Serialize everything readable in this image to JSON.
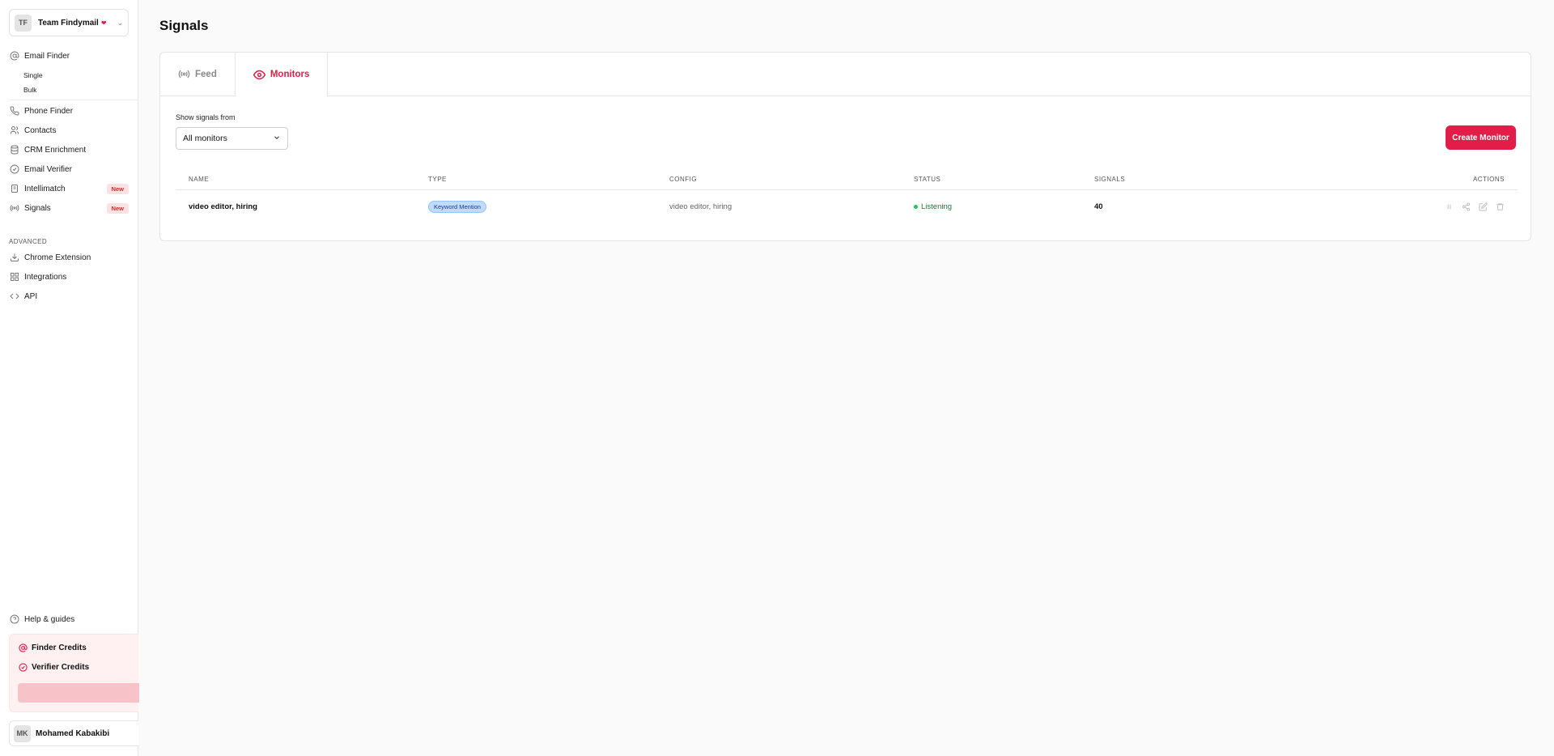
{
  "sidebar": {
    "team": {
      "initials": "TF",
      "name": "Team Findymail"
    },
    "nav": {
      "email_finder": "Email Finder",
      "single": "Single",
      "bulk": "Bulk",
      "phone_finder": "Phone Finder",
      "contacts": "Contacts",
      "crm_enrichment": "CRM Enrichment",
      "email_verifier": "Email Verifier",
      "intellimatch": "Intellimatch",
      "signals": "Signals",
      "new_badge": "New"
    },
    "advanced_label": "ADVANCED",
    "advanced": {
      "chrome_extension": "Chrome Extension",
      "integrations": "Integrations",
      "api": "API"
    },
    "help": "Help & guides",
    "credits": {
      "finder": "Finder Credits",
      "verifier": "Verifier Credits"
    },
    "user": {
      "initials": "MK",
      "name": "Mohamed Kabakibi"
    }
  },
  "main": {
    "title": "Signals",
    "tabs": {
      "feed": "Feed",
      "monitors": "Monitors"
    },
    "filter": {
      "label": "Show signals from",
      "value": "All monitors"
    },
    "create_button": "Create Monitor",
    "table": {
      "headers": {
        "name": "NAME",
        "type": "TYPE",
        "config": "CONFIG",
        "status": "STATUS",
        "signals": "SIGNALS",
        "actions": "ACTIONS"
      },
      "rows": [
        {
          "name": "video editor, hiring",
          "type": "Keyword Mention",
          "config": "video editor, hiring",
          "status": "Listening",
          "signals": "40"
        }
      ]
    }
  },
  "colors": {
    "accent": "#e11d48",
    "status_green": "#15803d",
    "badge_blue": "#bfdbfe"
  }
}
